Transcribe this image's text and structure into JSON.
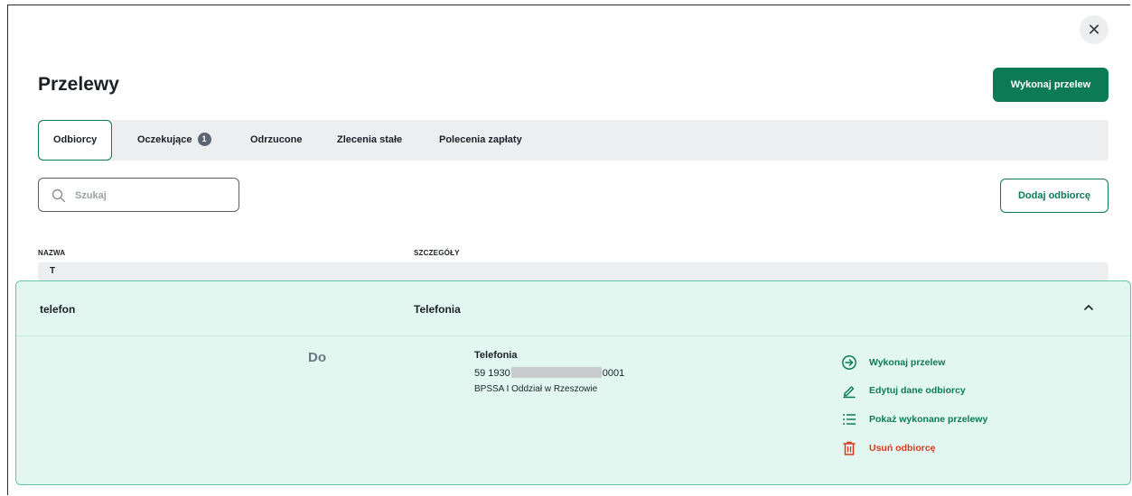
{
  "header": {
    "title": "Przelewy",
    "primary_action": "Wykonaj przelew",
    "close_symbol": "✕"
  },
  "tabs": [
    {
      "label": "Odbiorcy",
      "active": true
    },
    {
      "label": "Oczekujące",
      "badge": "1"
    },
    {
      "label": "Odrzucone"
    },
    {
      "label": "Zlecenia stałe"
    },
    {
      "label": "Polecenia zapłaty"
    }
  ],
  "search": {
    "placeholder": "Szukaj",
    "value": ""
  },
  "add_recipient_label": "Dodaj odbiorcę",
  "table": {
    "columns": [
      "NAZWA",
      "SZCZEGÓŁY"
    ],
    "group_letter": "T",
    "recipient": {
      "name": "telefon",
      "details": "Telefonia",
      "direction_label": "Do",
      "account_name": "Telefonia",
      "account_prefix": "59 1930",
      "account_suffix": "0001",
      "bank": "BPSSA I Oddział w Rzeszowie",
      "actions": [
        {
          "label": "Wykonaj przelew",
          "icon": "arrow-circle-right-icon",
          "color": "#0b7a55"
        },
        {
          "label": "Edytuj dane odbiorcy",
          "icon": "pencil-icon",
          "color": "#0b7a55"
        },
        {
          "label": "Pokaż wykonane przelewy",
          "icon": "list-icon",
          "color": "#0b7a55"
        },
        {
          "label": "Usuń odbiorcę",
          "icon": "trash-icon",
          "color": "#d9381e"
        }
      ]
    }
  },
  "colors": {
    "accent": "#0b7a55",
    "danger": "#d9381e",
    "expanded_bg": "#e3f7f1",
    "tab_bar_bg": "#eceef0"
  }
}
